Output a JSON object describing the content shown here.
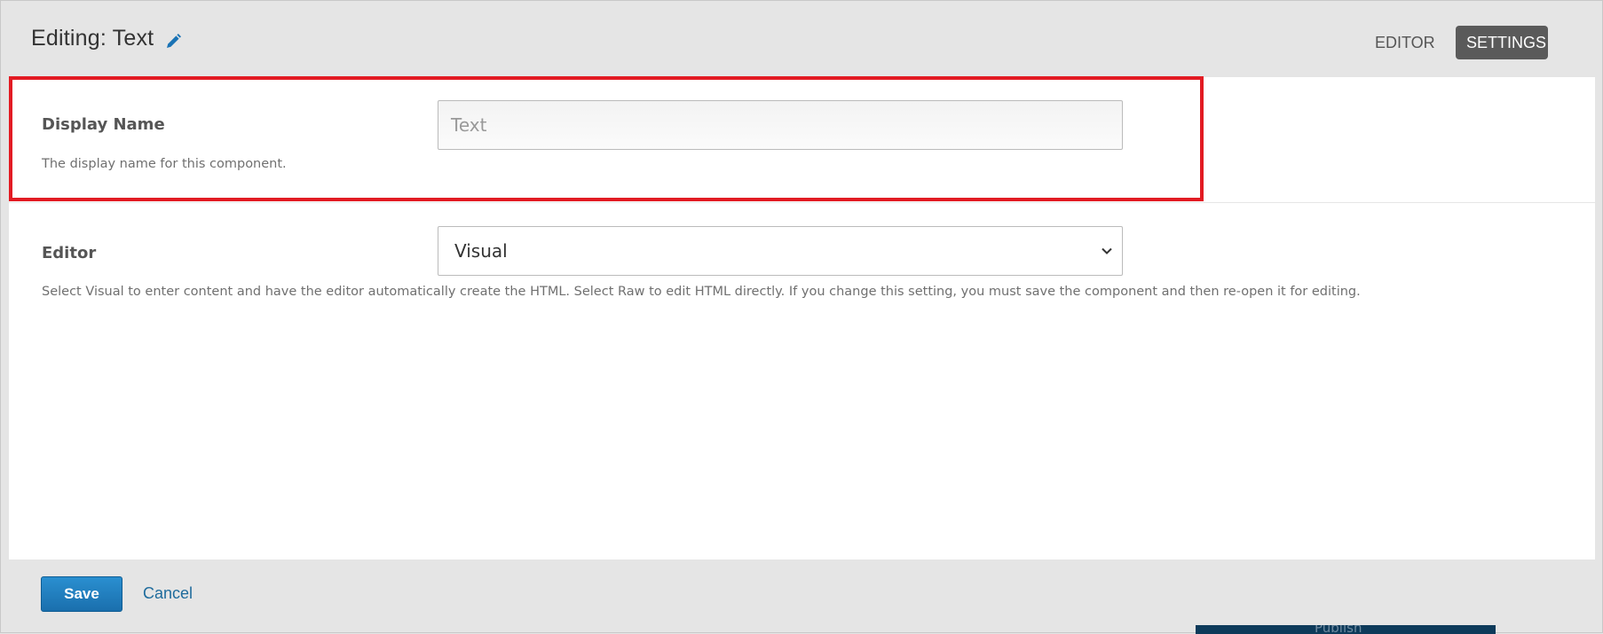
{
  "modal": {
    "title": "Editing: Text",
    "tabs": {
      "editor": "EDITOR",
      "settings": "SETTINGS"
    }
  },
  "fields": {
    "display_name": {
      "label": "Display Name",
      "value": "Text",
      "help": "The display name for this component."
    },
    "editor": {
      "label": "Editor",
      "selected": "Visual",
      "help": "Select Visual to enter content and have the editor automatically create the HTML. Select Raw to edit HTML directly. If you change this setting, you must save the component and then re-open it for editing."
    }
  },
  "footer": {
    "save_label": "Save",
    "cancel_label": "Cancel"
  },
  "background": {
    "partial_text": "Publish"
  },
  "colors": {
    "accent_blue": "#1a6fad",
    "highlight_red": "#e21b23",
    "active_tab": "#5a5a5a"
  },
  "icons": {
    "title_edit": "pencil-icon",
    "select_arrow": "chevron-down-icon"
  }
}
